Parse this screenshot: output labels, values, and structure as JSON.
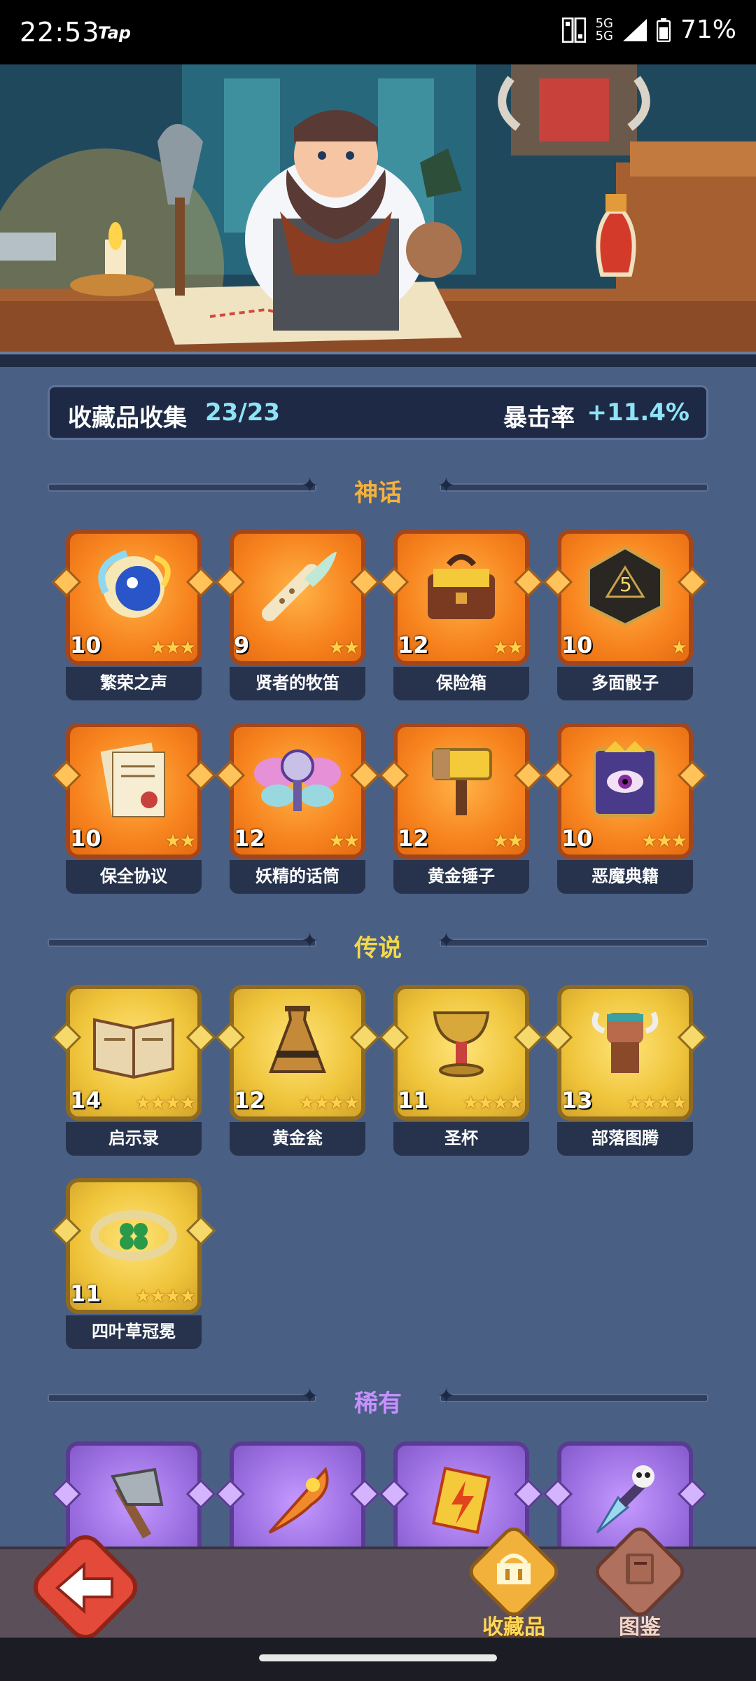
{
  "status": {
    "time": "22:53",
    "app": "Tap",
    "network_top": "5G",
    "network_bottom": "5G",
    "battery": "71%"
  },
  "summary": {
    "label": "收藏品收集",
    "count": "23/23",
    "crit_label": "暴击率",
    "crit_value": "+11.4%"
  },
  "sections": {
    "mythic": {
      "title": "神话",
      "color": "#f3b23c"
    },
    "legend": {
      "title": "传说",
      "color": "#f3d94a"
    },
    "rare": {
      "title": "稀有",
      "color": "#c790ff"
    }
  },
  "mythic_items": [
    {
      "name": "繁荣之声",
      "level": "10",
      "stars": "★★★",
      "icon": "prosperity-orb-icon"
    },
    {
      "name": "贤者的牧笛",
      "level": "9",
      "stars": "★★",
      "icon": "sage-flute-icon"
    },
    {
      "name": "保险箱",
      "level": "12",
      "stars": "★★",
      "icon": "safe-chest-icon"
    },
    {
      "name": "多面骰子",
      "level": "10",
      "stars": "★",
      "icon": "d20-dice-icon"
    },
    {
      "name": "保全协议",
      "level": "10",
      "stars": "★★",
      "icon": "contract-scroll-icon"
    },
    {
      "name": "妖精的话筒",
      "level": "12",
      "stars": "★★",
      "icon": "fairy-microphone-icon"
    },
    {
      "name": "黄金锤子",
      "level": "12",
      "stars": "★★",
      "icon": "golden-hammer-icon"
    },
    {
      "name": "恶魔典籍",
      "level": "10",
      "stars": "★★★",
      "icon": "demon-tome-icon"
    }
  ],
  "legend_items": [
    {
      "name": "启示录",
      "level": "14",
      "stars": "★★★★",
      "icon": "revelation-book-icon"
    },
    {
      "name": "黄金瓮",
      "level": "12",
      "stars": "★★★★",
      "icon": "golden-urn-icon"
    },
    {
      "name": "圣杯",
      "level": "11",
      "stars": "★★★★",
      "icon": "holy-grail-icon"
    },
    {
      "name": "部落图腾",
      "level": "13",
      "stars": "★★★★",
      "icon": "tribal-totem-icon"
    },
    {
      "name": "四叶草冠冕",
      "level": "11",
      "stars": "★★★★",
      "icon": "clover-crown-icon"
    }
  ],
  "rare_items": [
    {
      "icon": "stone-axe-icon"
    },
    {
      "icon": "phoenix-feather-icon"
    },
    {
      "icon": "thunder-scroll-icon"
    },
    {
      "icon": "skull-dagger-icon"
    }
  ],
  "nav": {
    "collection": "收藏品",
    "codex": "图鉴"
  }
}
